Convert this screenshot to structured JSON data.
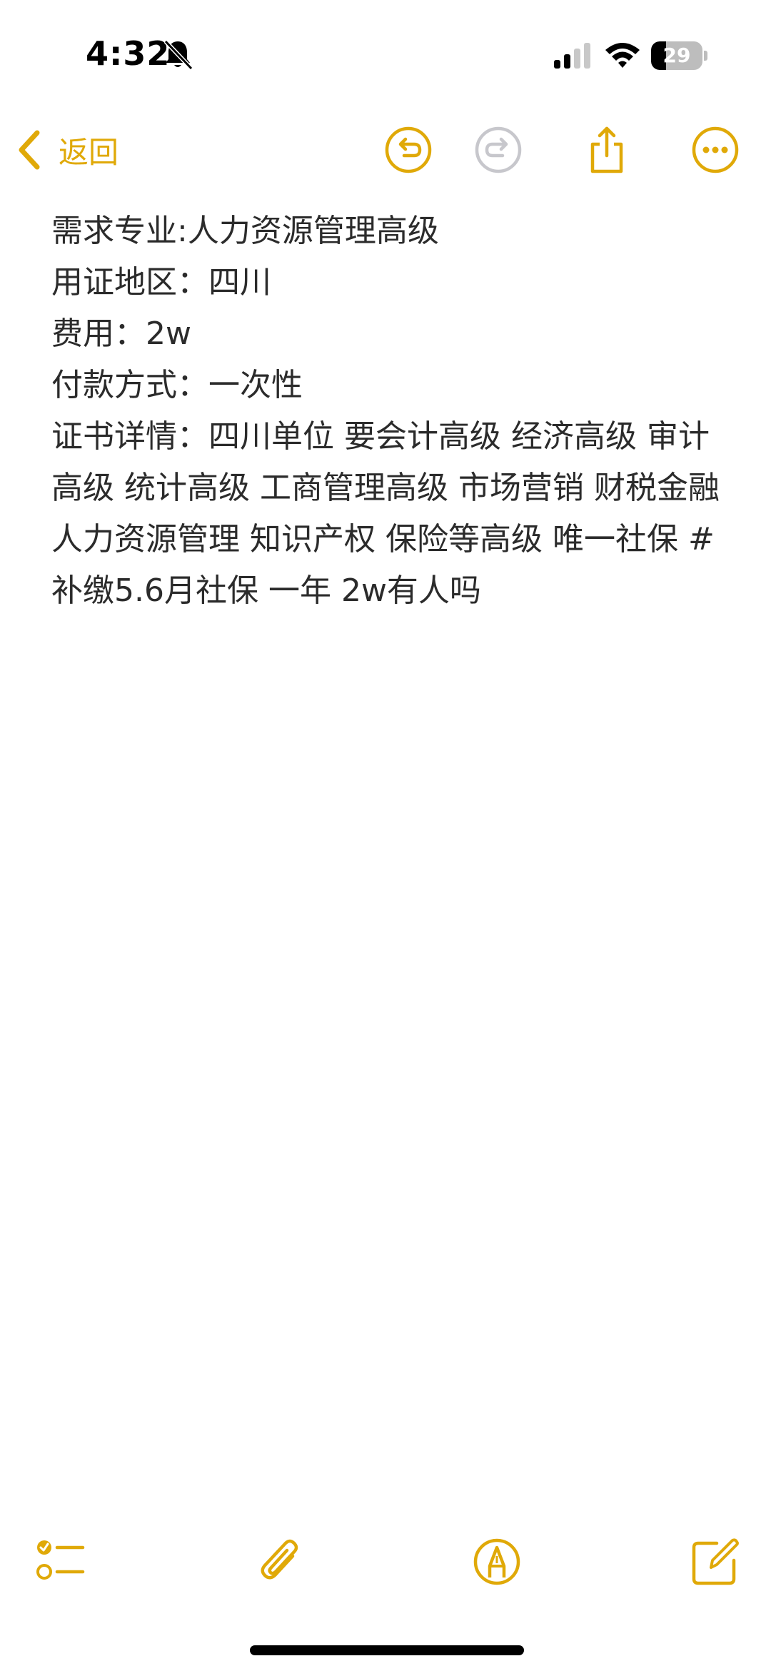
{
  "status_bar": {
    "time": "4:32",
    "battery_level": "29",
    "battery_fraction": 0.29
  },
  "nav": {
    "back_label": "返回",
    "accent_color": "#e0a908",
    "disabled_color": "#c7c7cc",
    "icons": [
      "chevron-left-icon",
      "undo-icon",
      "redo-icon",
      "share-icon",
      "more-icon"
    ]
  },
  "note": {
    "lines": [
      "需求专业:人力资源管理高级",
      "用证地区：四川",
      "费用：2w",
      "付款方式：一次性",
      "证书详情：四川单位 要会计高级 经济高级 审计高级 统计高级 工商管理高级 市场营销 财税金融 人力资源管理 知识产权 保险等高级 唯一社保 #补缴5.6月社保 一年 2w有人吗"
    ]
  },
  "toolbar": {
    "icons": [
      "checklist-icon",
      "paperclip-icon",
      "markup-pen-icon",
      "compose-icon"
    ]
  }
}
